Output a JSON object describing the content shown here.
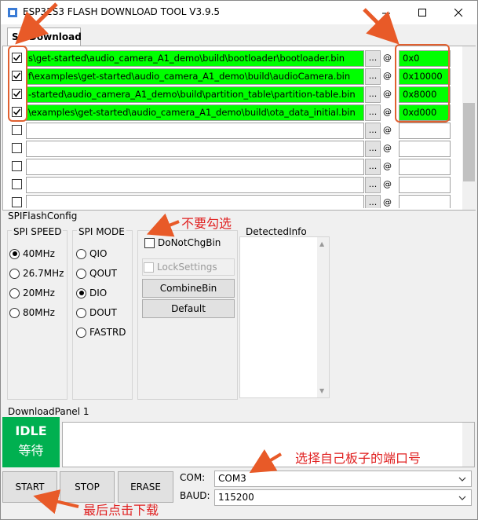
{
  "window": {
    "title": "ESP32S3 FLASH DOWNLOAD TOOL V3.9.5"
  },
  "tabs": [
    {
      "label": "SPIDownload"
    }
  ],
  "files": [
    {
      "checked": true,
      "path": "D:\\esp\\esp-who\\examples\\get-started\\audio_camera_A1_demo\\build\\bootloader\\bootloader.bin",
      "path_visible": "s\\get-started\\audio_camera_A1_demo\\build\\bootloader\\bootloader.bin",
      "address": "0x0",
      "highlight": true
    },
    {
      "checked": true,
      "path": "D:\\esp\\esp-who\\examples\\get-started\\audio_camera_A1_demo\\build\\audioCamera.bin",
      "path_visible": "f\\examples\\get-started\\audio_camera_A1_demo\\build\\audioCamera.bin",
      "address": "0x10000",
      "highlight": true
    },
    {
      "checked": true,
      "path": "D:\\esp\\esp-who\\examples\\get-started\\audio_camera_A1_demo\\build\\partition_table\\partition-table.bin",
      "path_visible": "-started\\audio_camera_A1_demo\\build\\partition_table\\partition-table.bin",
      "address": "0x8000",
      "highlight": true
    },
    {
      "checked": true,
      "path": "D:\\esp\\esp-who\\examples\\get-started\\audio_camera_A1_demo\\build\\ota_data_initial.bin",
      "path_visible": "\\examples\\get-started\\audio_camera_A1_demo\\build\\ota_data_initial.bin",
      "address": "0xd000",
      "highlight": true
    },
    {
      "checked": false,
      "path_visible": "",
      "address": "",
      "highlight": false
    },
    {
      "checked": false,
      "path_visible": "",
      "address": "",
      "highlight": false
    },
    {
      "checked": false,
      "path_visible": "",
      "address": "",
      "highlight": false
    },
    {
      "checked": false,
      "path_visible": "",
      "address": "",
      "highlight": false
    },
    {
      "checked": false,
      "path_visible": "",
      "address": "",
      "highlight": false
    }
  ],
  "browse_label": "...",
  "at_label": "@",
  "spiflashconfig": {
    "label": "SPIFlashConfig",
    "speed": {
      "label": "SPI SPEED",
      "options": [
        "40MHz",
        "26.7MHz",
        "20MHz",
        "80MHz"
      ],
      "selected": "40MHz"
    },
    "mode": {
      "label": "SPI MODE",
      "options": [
        "QIO",
        "QOUT",
        "DIO",
        "DOUT",
        "FASTRD"
      ],
      "selected": "DIO"
    },
    "donotchgbin": {
      "label": "DoNotChgBin",
      "checked": false
    },
    "locksettings": {
      "label": "LockSettings",
      "checked": false,
      "disabled": true
    },
    "combine_label": "CombineBin",
    "default_label": "Default",
    "detected_label": "DetectedInfo"
  },
  "download": {
    "panel_label": "DownloadPanel 1",
    "status_en": "IDLE",
    "status_cn": "等待",
    "status_color": "#00b050",
    "start_label": "START",
    "stop_label": "STOP",
    "erase_label": "ERASE",
    "com_label": "COM:",
    "com_value": "COM3",
    "baud_label": "BAUD:",
    "baud_value": "115200"
  },
  "annotations": {
    "no_check": "不要勾选",
    "select_port": "选择自己板子的端口号",
    "click_download": "最后点击下载",
    "color": "#e02020"
  }
}
